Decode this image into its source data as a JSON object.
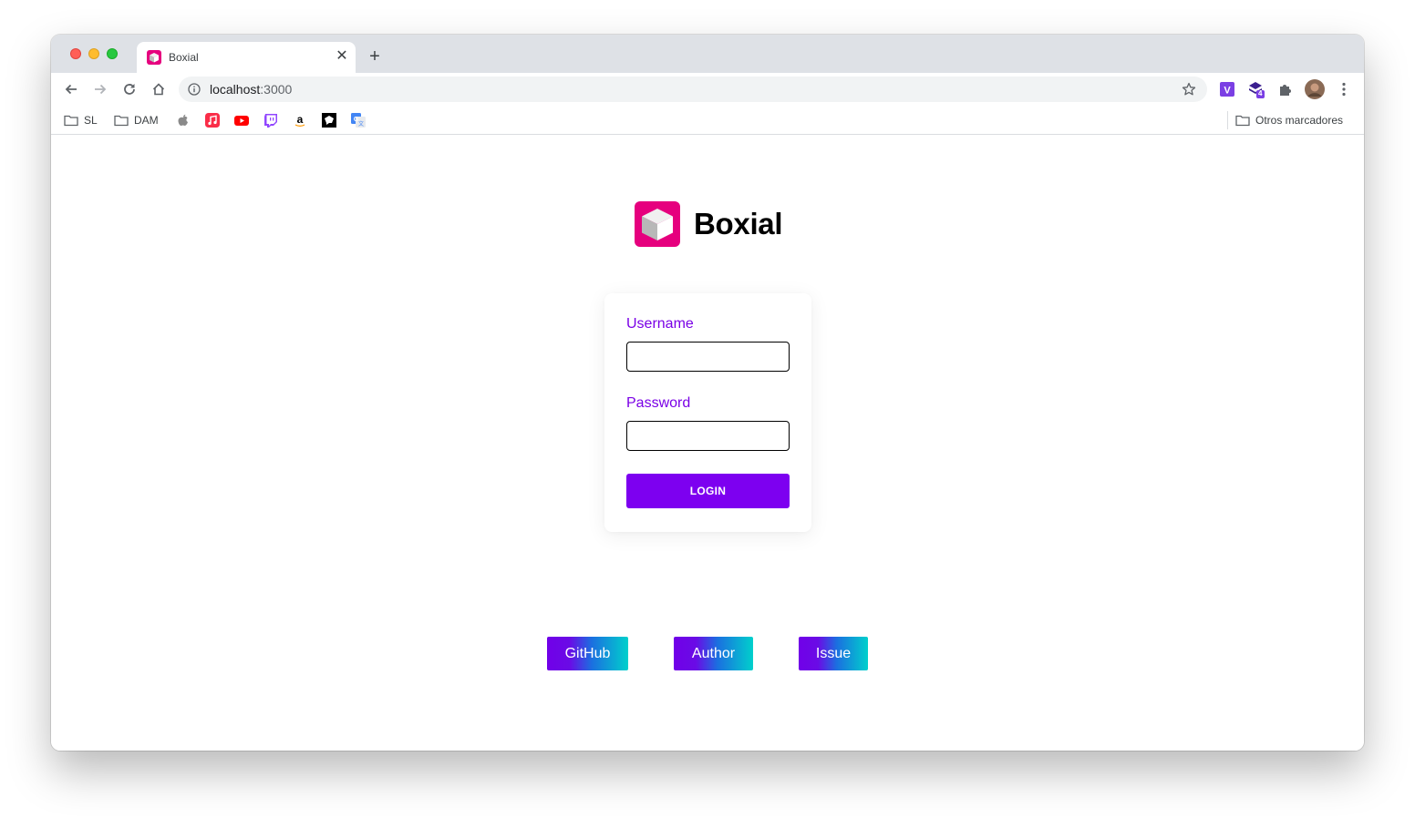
{
  "browser": {
    "tab": {
      "title": "Boxial",
      "favicon": "boxial-cube-icon",
      "close_glyph": "✕"
    },
    "new_tab_glyph": "+",
    "address": {
      "host": "localhost",
      "port": ":3000"
    },
    "bookmarks": [
      {
        "label": "SL",
        "icon": "folder-icon"
      },
      {
        "label": "DAM",
        "icon": "folder-icon"
      },
      {
        "label": "",
        "icon": "apple-icon"
      },
      {
        "label": "",
        "icon": "apple-music-icon"
      },
      {
        "label": "",
        "icon": "youtube-icon"
      },
      {
        "label": "",
        "icon": "twitch-icon"
      },
      {
        "label": "",
        "icon": "amazon-icon"
      },
      {
        "label": "",
        "icon": "chat-icon"
      },
      {
        "label": "",
        "icon": "google-translate-icon"
      }
    ],
    "other_bookmarks": "Otros marcadores",
    "extension_badge": "4"
  },
  "app": {
    "name": "Boxial",
    "logo": "boxial-cube-icon",
    "brand_color": "#e6007e",
    "accent_color": "#7d00f0"
  },
  "login_form": {
    "username_label": "Username",
    "username_value": "",
    "password_label": "Password",
    "password_value": "",
    "submit_label": "LOGIN"
  },
  "footer_links": [
    {
      "label": "GitHub"
    },
    {
      "label": "Author"
    },
    {
      "label": "Issue"
    }
  ]
}
